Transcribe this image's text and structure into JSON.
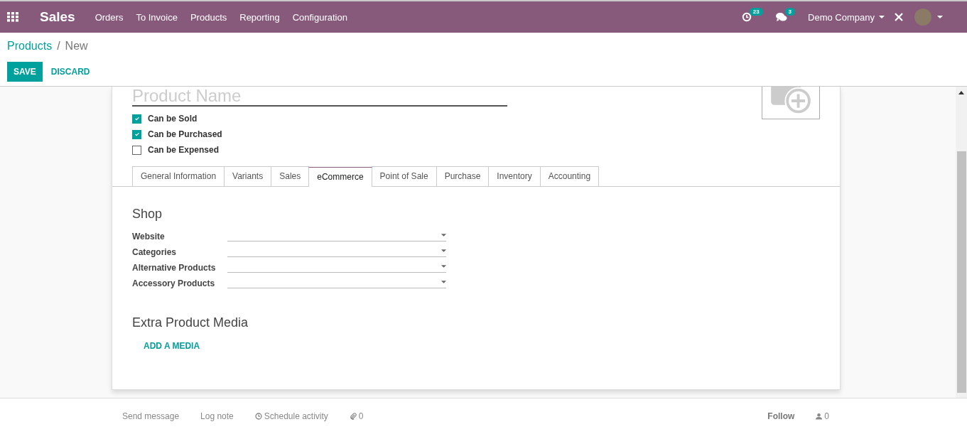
{
  "navbar": {
    "app_name": "Sales",
    "menu": [
      "Orders",
      "To Invoice",
      "Products",
      "Reporting",
      "Configuration"
    ],
    "activity_count": "23",
    "message_count": "3",
    "company": "Demo Company"
  },
  "breadcrumb": {
    "parent": "Products",
    "separator": "/",
    "current": "New"
  },
  "buttons": {
    "save": "SAVE",
    "discard": "DISCARD"
  },
  "form": {
    "name_placeholder": "Product Name",
    "options": [
      {
        "label": "Can be Sold",
        "checked": true
      },
      {
        "label": "Can be Purchased",
        "checked": true
      },
      {
        "label": "Can be Expensed",
        "checked": false
      }
    ],
    "tabs": [
      {
        "label": "General Information",
        "selected": false
      },
      {
        "label": "Variants",
        "selected": false
      },
      {
        "label": "Sales",
        "selected": false
      },
      {
        "label": "eCommerce",
        "selected": true
      },
      {
        "label": "Point of Sale",
        "selected": false
      },
      {
        "label": "Purchase",
        "selected": false
      },
      {
        "label": "Inventory",
        "selected": false
      },
      {
        "label": "Accounting",
        "selected": false
      }
    ],
    "shop": {
      "title": "Shop",
      "fields": [
        "Website",
        "Categories",
        "Alternative Products",
        "Accessory Products"
      ]
    },
    "media": {
      "title": "Extra Product Media",
      "add_button": "ADD A MEDIA"
    }
  },
  "chatter": {
    "send_message": "Send message",
    "log_note": "Log note",
    "schedule_activity": "Schedule activity",
    "attachments": "0",
    "follow": "Follow",
    "followers": "0"
  }
}
